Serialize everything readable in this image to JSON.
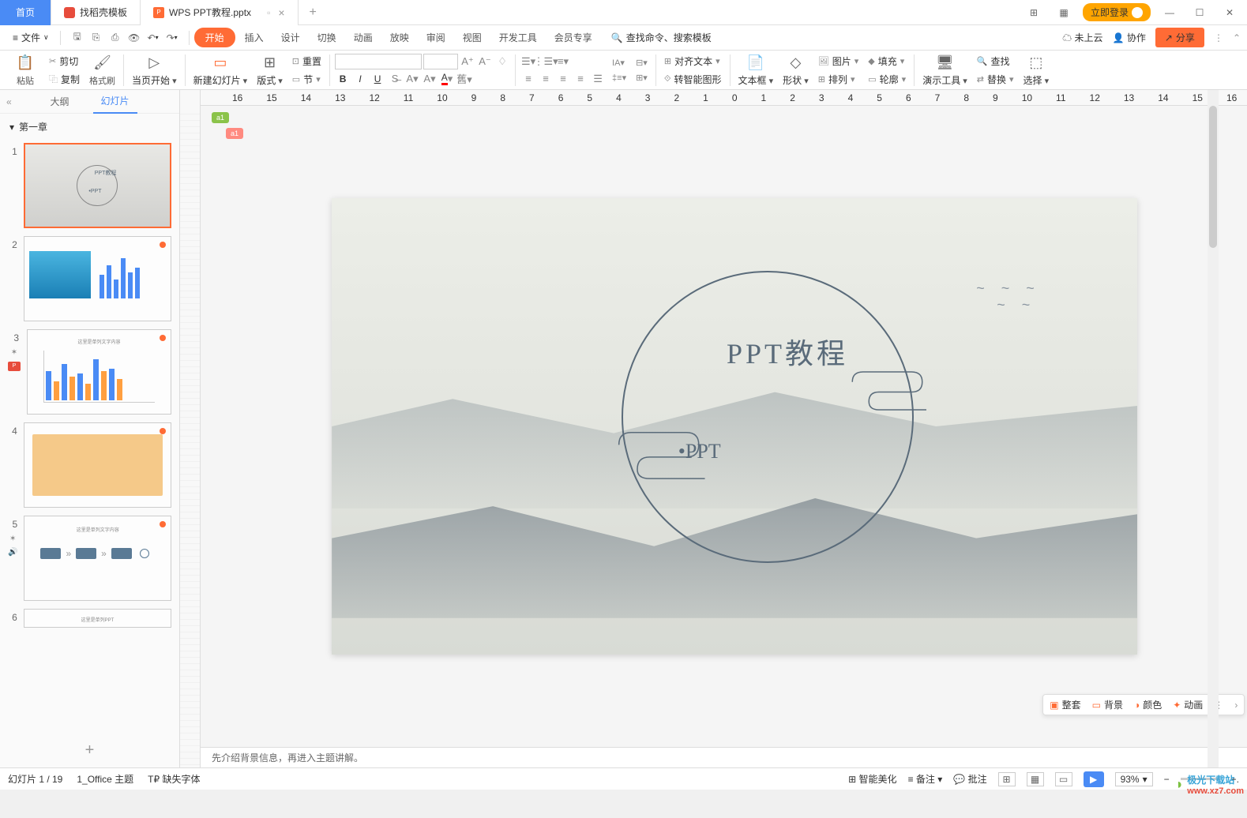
{
  "titlebar": {
    "home": "首页",
    "tab1": "找稻壳模板",
    "tab2": "WPS PPT教程.pptx",
    "login": "立即登录"
  },
  "menubar": {
    "file": "文件",
    "tabs": [
      "开始",
      "插入",
      "设计",
      "切换",
      "动画",
      "放映",
      "审阅",
      "视图",
      "开发工具",
      "会员专享"
    ],
    "search_placeholder": "查找命令、搜索模板",
    "cloud": "未上云",
    "collab": "协作",
    "share": "分享"
  },
  "ribbon": {
    "paste": "粘贴",
    "cut": "剪切",
    "copy": "复制",
    "format_painter": "格式刷",
    "from_current": "当页开始",
    "new_slide": "新建幻灯片",
    "layout": "版式",
    "section": "节",
    "reset": "重置",
    "align_text": "对齐文本",
    "smart_graphic": "转智能图形",
    "textbox": "文本框",
    "shape": "形状",
    "arrange": "排列",
    "picture": "图片",
    "fill": "填充",
    "outline": "轮廓",
    "present_tools": "演示工具",
    "find": "查找",
    "replace": "替换",
    "select": "选择"
  },
  "panel": {
    "outline_tab": "大纲",
    "slides_tab": "幻灯片",
    "section1": "第一章"
  },
  "slide": {
    "title": "PPT教程",
    "subtitle": "•PPT",
    "comment1": "a1",
    "comment2": "a1"
  },
  "ruler_marks": [
    "1",
    "16",
    "15",
    "14",
    "13",
    "12",
    "11",
    "10",
    "9",
    "8",
    "7",
    "6",
    "5",
    "4",
    "3",
    "2",
    "1",
    "0",
    "1",
    "2",
    "3",
    "4",
    "5",
    "6",
    "7",
    "8",
    "9",
    "10",
    "11",
    "12",
    "13",
    "14",
    "15",
    "16"
  ],
  "notes": "先介绍背景信息，再进入主题讲解。",
  "quickbar": {
    "theme": "整套",
    "background": "背景",
    "color": "颜色",
    "animation": "动画"
  },
  "statusbar": {
    "slide_info": "幻灯片 1 / 19",
    "theme_name": "1_Office 主题",
    "missing_fonts": "缺失字体",
    "smart_beautify": "智能美化",
    "notes_btn": "备注",
    "comments_btn": "批注",
    "zoom": "93%"
  },
  "watermark": {
    "text1": "极光下载站",
    "text2": "www.xz7.com"
  }
}
